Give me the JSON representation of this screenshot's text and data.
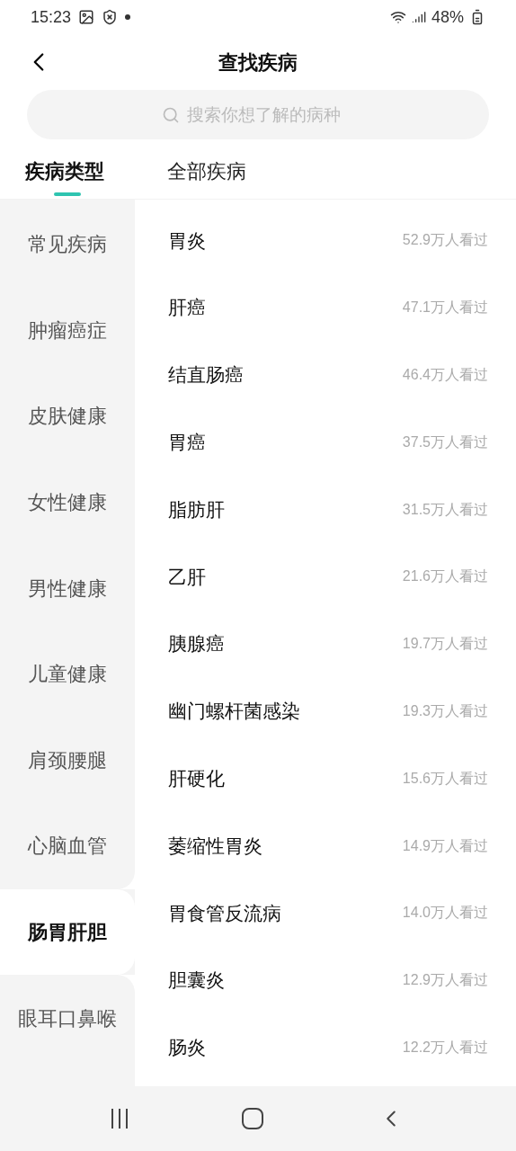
{
  "status_bar": {
    "time": "15:23",
    "battery": "48%"
  },
  "header": {
    "title": "查找疾病"
  },
  "search": {
    "placeholder": "搜索你想了解的病种"
  },
  "tabs": [
    {
      "label": "疾病类型",
      "selected": true
    },
    {
      "label": "全部疾病",
      "selected": false
    }
  ],
  "categories": [
    {
      "label": "常见疾病",
      "selected": false
    },
    {
      "label": "肿瘤癌症",
      "selected": false
    },
    {
      "label": "皮肤健康",
      "selected": false
    },
    {
      "label": "女性健康",
      "selected": false
    },
    {
      "label": "男性健康",
      "selected": false
    },
    {
      "label": "儿童健康",
      "selected": false
    },
    {
      "label": "肩颈腰腿",
      "selected": false
    },
    {
      "label": "心脑血管",
      "selected": false
    },
    {
      "label": "肠胃肝胆",
      "selected": true
    },
    {
      "label": "眼耳口鼻喉",
      "selected": false
    }
  ],
  "diseases": [
    {
      "name": "胃炎",
      "views": "52.9万人看过"
    },
    {
      "name": "肝癌",
      "views": "47.1万人看过"
    },
    {
      "name": "结直肠癌",
      "views": "46.4万人看过"
    },
    {
      "name": "胃癌",
      "views": "37.5万人看过"
    },
    {
      "name": "脂肪肝",
      "views": "31.5万人看过"
    },
    {
      "name": "乙肝",
      "views": "21.6万人看过"
    },
    {
      "name": "胰腺癌",
      "views": "19.7万人看过"
    },
    {
      "name": "幽门螺杆菌感染",
      "views": "19.3万人看过"
    },
    {
      "name": "肝硬化",
      "views": "15.6万人看过"
    },
    {
      "name": "萎缩性胃炎",
      "views": "14.9万人看过"
    },
    {
      "name": "胃食管反流病",
      "views": "14.0万人看过"
    },
    {
      "name": "胆囊炎",
      "views": "12.9万人看过"
    },
    {
      "name": "肠炎",
      "views": "12.2万人看过"
    }
  ]
}
